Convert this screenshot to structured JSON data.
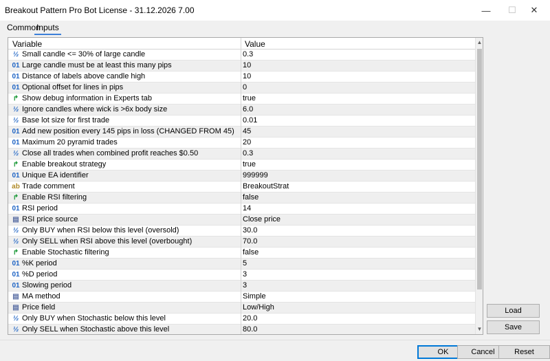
{
  "window": {
    "title": "Breakout Pattern Pro Bot License - 31.12.2026 7.00",
    "minimize": "—",
    "maximize": "☐",
    "close": "✕"
  },
  "tabs": [
    {
      "label": "Common"
    },
    {
      "label": "Inputs"
    }
  ],
  "grid": {
    "header_variable": "Variable",
    "header_value": "Value",
    "rows": [
      {
        "icon": "fraction-icon",
        "glyph": "½",
        "name": "Small candle <= 30% of large candle",
        "value": "0.3"
      },
      {
        "icon": "integer-icon",
        "glyph": "01",
        "name": "Large candle must be at least this many pips",
        "value": "10"
      },
      {
        "icon": "integer-icon",
        "glyph": "01",
        "name": "Distance of labels above candle high",
        "value": "10"
      },
      {
        "icon": "integer-icon",
        "glyph": "01",
        "name": "Optional offset for lines in pips",
        "value": "0"
      },
      {
        "icon": "bool-arrow-icon",
        "glyph": "↱",
        "name": "Show debug information in Experts tab",
        "value": "true"
      },
      {
        "icon": "fraction-icon",
        "glyph": "½",
        "name": "Ignore candles where wick is >6x body size",
        "value": "6.0"
      },
      {
        "icon": "fraction-icon",
        "glyph": "½",
        "name": "Base lot size for first trade",
        "value": "0.01"
      },
      {
        "icon": "integer-icon",
        "glyph": "01",
        "name": "Add new position every 145 pips in loss (CHANGED FROM 45)",
        "value": "45"
      },
      {
        "icon": "integer-icon",
        "glyph": "01",
        "name": "Maximum 20 pyramid trades",
        "value": "20"
      },
      {
        "icon": "fraction-icon",
        "glyph": "½",
        "name": "Close all trades when combined profit reaches $0.50",
        "value": "0.3"
      },
      {
        "icon": "bool-arrow-icon",
        "glyph": "↱",
        "name": "Enable breakout strategy",
        "value": "true"
      },
      {
        "icon": "integer-icon",
        "glyph": "01",
        "name": "Unique EA identifier",
        "value": "999999"
      },
      {
        "icon": "string-icon",
        "glyph": "ab",
        "name": "Trade comment",
        "value": "BreakoutStrat"
      },
      {
        "icon": "bool-arrow-icon",
        "glyph": "↱",
        "name": "Enable RSI filtering",
        "value": "false"
      },
      {
        "icon": "integer-icon",
        "glyph": "01",
        "name": "RSI period",
        "value": "14"
      },
      {
        "icon": "enum-icon",
        "glyph": "▤",
        "name": "RSI price source",
        "value": "Close price"
      },
      {
        "icon": "fraction-icon",
        "glyph": "½",
        "name": "Only BUY when RSI below this level (oversold)",
        "value": "30.0"
      },
      {
        "icon": "fraction-icon",
        "glyph": "½",
        "name": "Only SELL when RSI above this level (overbought)",
        "value": "70.0"
      },
      {
        "icon": "bool-arrow-icon",
        "glyph": "↱",
        "name": "Enable Stochastic filtering",
        "value": "false"
      },
      {
        "icon": "integer-icon",
        "glyph": "01",
        "name": "%K period",
        "value": "5"
      },
      {
        "icon": "integer-icon",
        "glyph": "01",
        "name": "%D period",
        "value": "3"
      },
      {
        "icon": "integer-icon",
        "glyph": "01",
        "name": "Slowing period",
        "value": "3"
      },
      {
        "icon": "enum-icon",
        "glyph": "▤",
        "name": "MA method",
        "value": "Simple"
      },
      {
        "icon": "enum-icon",
        "glyph": "▤",
        "name": "Price field",
        "value": "Low/High"
      },
      {
        "icon": "fraction-icon",
        "glyph": "½",
        "name": "Only BUY when Stochastic below this level",
        "value": "20.0"
      },
      {
        "icon": "fraction-icon",
        "glyph": "½",
        "name": "Only SELL when Stochastic above this level",
        "value": "80.0"
      }
    ]
  },
  "side_buttons": {
    "load": "Load",
    "save": "Save"
  },
  "footer": {
    "ok": "OK",
    "cancel": "Cancel",
    "reset": "Reset"
  },
  "colors": {
    "accent": "#0078d7",
    "tab_underline": "#3c7fd9"
  }
}
